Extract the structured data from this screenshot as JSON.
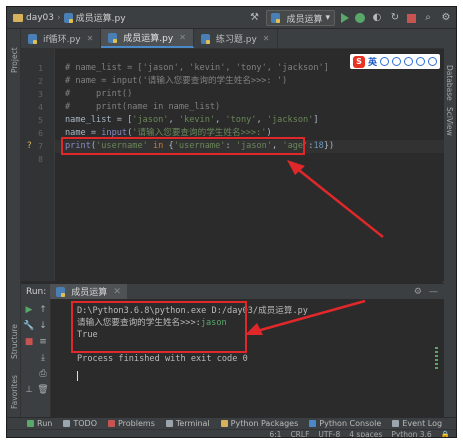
{
  "breadcrumb": {
    "project": "day03",
    "file": "成员运算.py"
  },
  "run_config": {
    "label": "成员运算"
  },
  "tabs": [
    {
      "label": "if循环.py",
      "active": false
    },
    {
      "label": "成员运算.py",
      "active": true
    },
    {
      "label": "练习题.py",
      "active": false
    }
  ],
  "left_strip": {
    "project": "Project",
    "structure": "Structure",
    "favorites": "Favorites"
  },
  "right_strip": {
    "database": "Database",
    "sciview": "SciView"
  },
  "translate_widget": {
    "logo": "S",
    "label": "英"
  },
  "editor": {
    "line_numbers": [
      "1",
      "2",
      "3",
      "4",
      "5",
      "6",
      "7",
      "8"
    ],
    "lines": [
      {
        "parts": [
          {
            "t": "# name_list = ['jason', 'kevin', 'tony', 'jackson']",
            "c": "c-com"
          }
        ]
      },
      {
        "parts": [
          {
            "t": "# name = input('请输入您要查询的学生姓名>>>: ')",
            "c": "c-com"
          }
        ]
      },
      {
        "parts": [
          {
            "t": "#     print()",
            "c": "c-com"
          }
        ]
      },
      {
        "parts": [
          {
            "t": "#     print(name in name_list)",
            "c": "c-com"
          }
        ]
      },
      {
        "parts": [
          {
            "t": "name_list = [",
            "c": "c-var"
          },
          {
            "t": "'jason'",
            "c": "c-str"
          },
          {
            "t": ", ",
            "c": "c-var"
          },
          {
            "t": "'kevin'",
            "c": "c-str"
          },
          {
            "t": ", ",
            "c": "c-var"
          },
          {
            "t": "'tony'",
            "c": "c-str"
          },
          {
            "t": ", ",
            "c": "c-var"
          },
          {
            "t": "'jackson'",
            "c": "c-str"
          },
          {
            "t": "]",
            "c": "c-var"
          }
        ]
      },
      {
        "parts": [
          {
            "t": "name = ",
            "c": "c-var"
          },
          {
            "t": "input",
            "c": "c-fn"
          },
          {
            "t": "(",
            "c": "c-var"
          },
          {
            "t": "'请输入您要查询的学生姓名>>>:'",
            "c": "c-str"
          },
          {
            "t": ")",
            "c": "c-var"
          }
        ]
      },
      {
        "parts": [
          {
            "t": "print",
            "c": "c-fn"
          },
          {
            "t": "(",
            "c": "c-var"
          },
          {
            "t": "'username'",
            "c": "c-str"
          },
          {
            "t": " in ",
            "c": "c-kw"
          },
          {
            "t": "{",
            "c": "c-var"
          },
          {
            "t": "'username'",
            "c": "c-str"
          },
          {
            "t": ": ",
            "c": "c-var"
          },
          {
            "t": "'jason'",
            "c": "c-str"
          },
          {
            "t": ", ",
            "c": "c-var"
          },
          {
            "t": "'age'",
            "c": "c-str"
          },
          {
            "t": ":",
            "c": "c-var"
          },
          {
            "t": "18",
            "c": "c-num"
          },
          {
            "t": "})",
            "c": "c-var"
          }
        ]
      },
      {
        "parts": []
      }
    ]
  },
  "run_panel": {
    "title": "Run:",
    "tab_label": "成员运算",
    "console": [
      {
        "text": "D:\\Python3.6.8\\python.exe D:/day03/成员运算.py",
        "color": "#bbbbbb"
      },
      {
        "prompt": "请输入您要查询的学生姓名>>>:",
        "input": "jason"
      },
      {
        "text": "True",
        "color": "#bbbbbb"
      },
      {
        "text": "",
        "color": "#bbbbbb"
      },
      {
        "text": "Process finished with exit code 0",
        "color": "#bbbbbb"
      }
    ]
  },
  "bottom_bar": [
    {
      "label": "Run",
      "color": "#59a869"
    },
    {
      "label": "TODO",
      "color": "#9aa5ae"
    },
    {
      "label": "Problems",
      "color": "#c75450"
    },
    {
      "label": "Terminal",
      "color": "#9aa5ae"
    },
    {
      "label": "Python Packages",
      "color": "#d8b25a"
    },
    {
      "label": "Python Console",
      "color": "#4a88c7"
    },
    {
      "label": "Event Log",
      "color": "#9aa5ae"
    }
  ],
  "status_bar": {
    "position": "6:1",
    "line_sep": "CRLF",
    "encoding": "UTF-8",
    "indent": "4 spaces",
    "interpreter": "Python 3.6"
  },
  "colors": {
    "highlight_box": "#e0282a",
    "accent": "#4a88c7",
    "run_green": "#59a869"
  }
}
